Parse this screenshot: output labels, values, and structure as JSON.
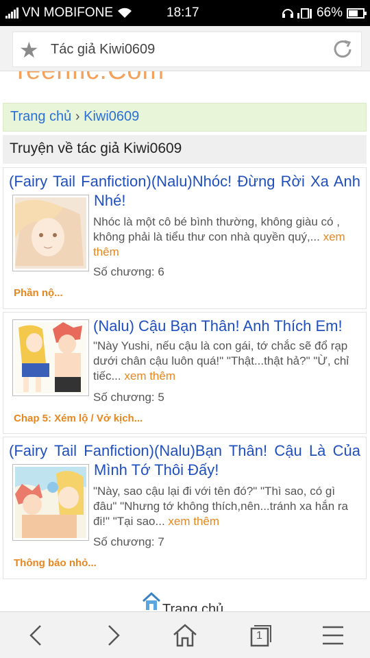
{
  "status_bar": {
    "carrier": "VN MOBIFONE",
    "time": "18:17",
    "battery": "66%"
  },
  "address_bar": {
    "title": "Tác giả Kiwi0609",
    "icons": [
      "star-icon",
      "reload-icon"
    ]
  },
  "logo_text": "Teenfic.Com",
  "breadcrumb": {
    "home": "Trang chủ",
    "separator": "›",
    "current": "Kiwi0609"
  },
  "section_title": "Truyện về tác giả Kiwi0609",
  "stories": [
    {
      "title": "(Fairy Tail Fanfiction)(Nalu)Nhóc! Đừng Rời Xa Anh Nhé!",
      "excerpt": "Nhóc là một cô bé bình thường, không giàu có , không phải là tiểu thư con nhà quyền quý,...",
      "more": "xem thêm",
      "chapters": "Số chương: 6",
      "latest": "Phần nộ..."
    },
    {
      "title": "(Nalu) Cậu Bạn Thân! Anh Thích Em!",
      "excerpt": "\"Này Yushi, nếu cậu là con gái, tớ chắc sẽ đổ rạp dưới chân cậu luôn quá!\" \"Thật...thật hả?\" \"Ừ, chỉ tiếc...",
      "more": "xem thêm",
      "chapters": "Số chương: 5",
      "latest": "Chap 5: Xém lộ / Vở kịch..."
    },
    {
      "title": "(Fairy Tail Fanfiction)(Nalu)Bạn Thân! Cậu Là Của Mình Tớ Thôi Đấy!",
      "excerpt": "\"Này, sao cậu lại đi với tên đó?\" \"Thì sao, có gì đâu\" \"Nhưng tớ không thích,nên...tránh xa hắn ra đi!\" \"Tại sao...",
      "more": "xem thêm",
      "chapters": "Số chương: 7",
      "latest": "Thông báo nhỏ..."
    }
  ],
  "footer": {
    "home_label": "Trang chủ"
  },
  "bottom_nav": {
    "tab_count": "1",
    "icons": [
      "back-icon",
      "forward-icon",
      "home-icon",
      "tabs-icon",
      "menu-icon"
    ]
  },
  "colors": {
    "link": "#1f4fbf",
    "accent": "#e8861e",
    "breadcrumb_bg": "#e9f5d9",
    "logo": "#f2a25c"
  }
}
